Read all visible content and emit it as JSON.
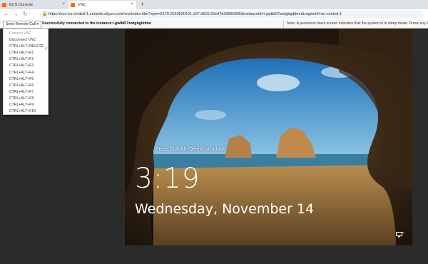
{
  "browser": {
    "tabs": [
      {
        "label": "ECS Console",
        "active": false
      },
      {
        "label": "VNC",
        "active": true
      }
    ],
    "url": "https://ecs-eu-central-1.console.aliyun.com/vnc/index.htm?spm=5176.2020520101.107.d515.60e47d33665f5f5&instanceId=i-gw8d07zwtgbgibfmu&regionId=eu-central-1"
  },
  "vnc_bar": {
    "send_button_label": "Send Remote Call",
    "status_message": "Successfully connected to the instance:i-gw8d07zwtgbgibfmu",
    "note": "Note: A persistent black screen indicates that the system is in sleep mode. Press any key to activate"
  },
  "menu": {
    "items": [
      {
        "label": "Connect VNC",
        "disabled": true
      },
      {
        "label": "Disconnect VNC",
        "disabled": false
      },
      {
        "label": "CTRL+ALT+DELETE",
        "disabled": false
      },
      {
        "label": "CTRL+ALT+F1",
        "disabled": false
      },
      {
        "label": "CTRL+ALT+F2",
        "disabled": false
      },
      {
        "label": "CTRL+ALT+F3",
        "disabled": false
      },
      {
        "label": "CTRL+ALT+F4",
        "disabled": false
      },
      {
        "label": "CTRL+ALT+F5",
        "disabled": false
      },
      {
        "label": "CTRL+ALT+F6",
        "disabled": false
      },
      {
        "label": "CTRL+ALT+F7",
        "disabled": false
      },
      {
        "label": "CTRL+ALT+F8",
        "disabled": false
      },
      {
        "label": "CTRL+ALT+F9",
        "disabled": false
      },
      {
        "label": "CTRL+ALT+F10",
        "disabled": false
      }
    ]
  },
  "lock_screen": {
    "prompt": "Press Ctrl+Alt+Delete to unlock.",
    "time": "3:19",
    "date": "Wednesday, November 14"
  },
  "colors": {
    "tab_strip": "#dee1e6",
    "screen_bg": "#2b2b2b",
    "sky": "#2f86c6",
    "sea": "#3b7fa0",
    "sand": "#c69a55"
  }
}
